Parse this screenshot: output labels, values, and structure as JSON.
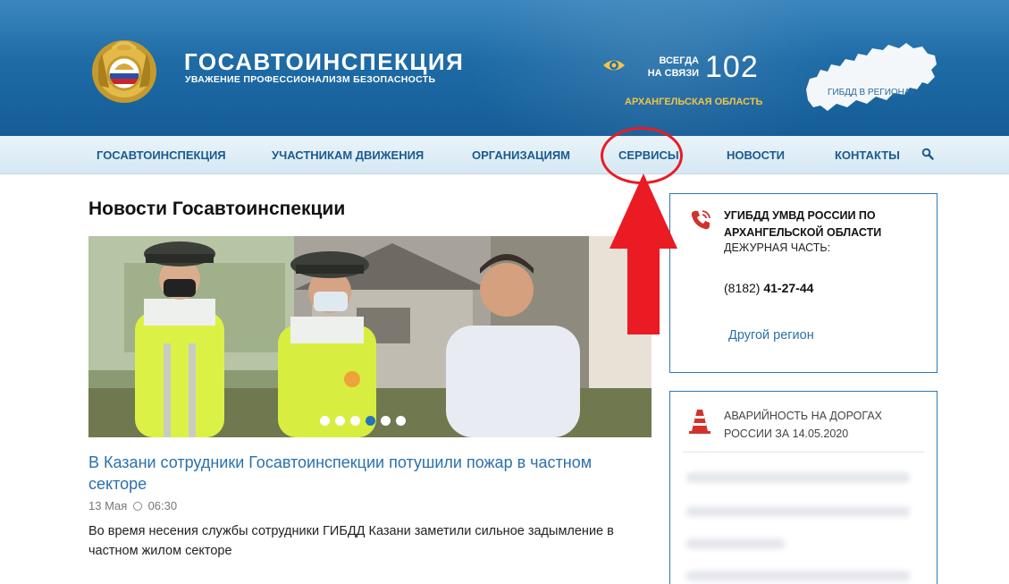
{
  "header": {
    "brand_title": "ГОСАВТОИНСПЕКЦИЯ",
    "brand_subtitle": "УВАЖЕНИЕ ПРОФЕССИОНАЛИЗМ БЕЗОПАСНОСТЬ",
    "always_line1": "ВСЕГДА",
    "always_line2": "НА СВЯЗИ",
    "hotline_number": "102",
    "region": "АРХАНГЕЛЬСКАЯ ОБЛАСТЬ",
    "map_label": "ГИБДД В РЕГИОНАХ"
  },
  "nav": {
    "items": [
      {
        "label": "ГОСАВТОИНСПЕКЦИЯ"
      },
      {
        "label": "УЧАСТНИКАМ ДВИЖЕНИЯ"
      },
      {
        "label": "ОРГАНИЗАЦИЯМ"
      },
      {
        "label": "СЕРВИСЫ"
      },
      {
        "label": "НОВОСТИ"
      },
      {
        "label": "КОНТАКТЫ"
      }
    ],
    "search_icon": "search-icon"
  },
  "main": {
    "heading": "Новости Госавтоинспекции",
    "slider": {
      "dot_count": 6,
      "active_dot": 4
    },
    "article": {
      "title": "В Казани сотрудники Госавтоинспекции потушили пожар в частном секторе",
      "date": "13 Мая",
      "time": "06:30",
      "text": "Во время несения службы сотрудники ГИБДД Казани заметили сильное задымление в частном жилом секторе"
    }
  },
  "sidebar": {
    "contact": {
      "icon": "phone-icon",
      "title": "УГИБДД УМВД РОССИИ ПО АРХАНГЕЛЬСКОЙ ОБЛАСТИ",
      "subtitle": "ДЕЖУРНАЯ ЧАСТЬ:",
      "phone_code": "(8182)",
      "phone_number": "41-27-44",
      "other_region_link": "Другой регион"
    },
    "accidents": {
      "icon": "traffic-cone-icon",
      "title": "АВАРИЙНОСТЬ НА ДОРОГАХ РОССИИ ЗА 14.05.2020"
    }
  },
  "colors": {
    "header_blue": "#1e6ba6",
    "nav_text": "#1b5a8f",
    "link_blue": "#2a70ad",
    "region_gold": "#f1c44a",
    "annotation_red": "#ea1b23"
  }
}
